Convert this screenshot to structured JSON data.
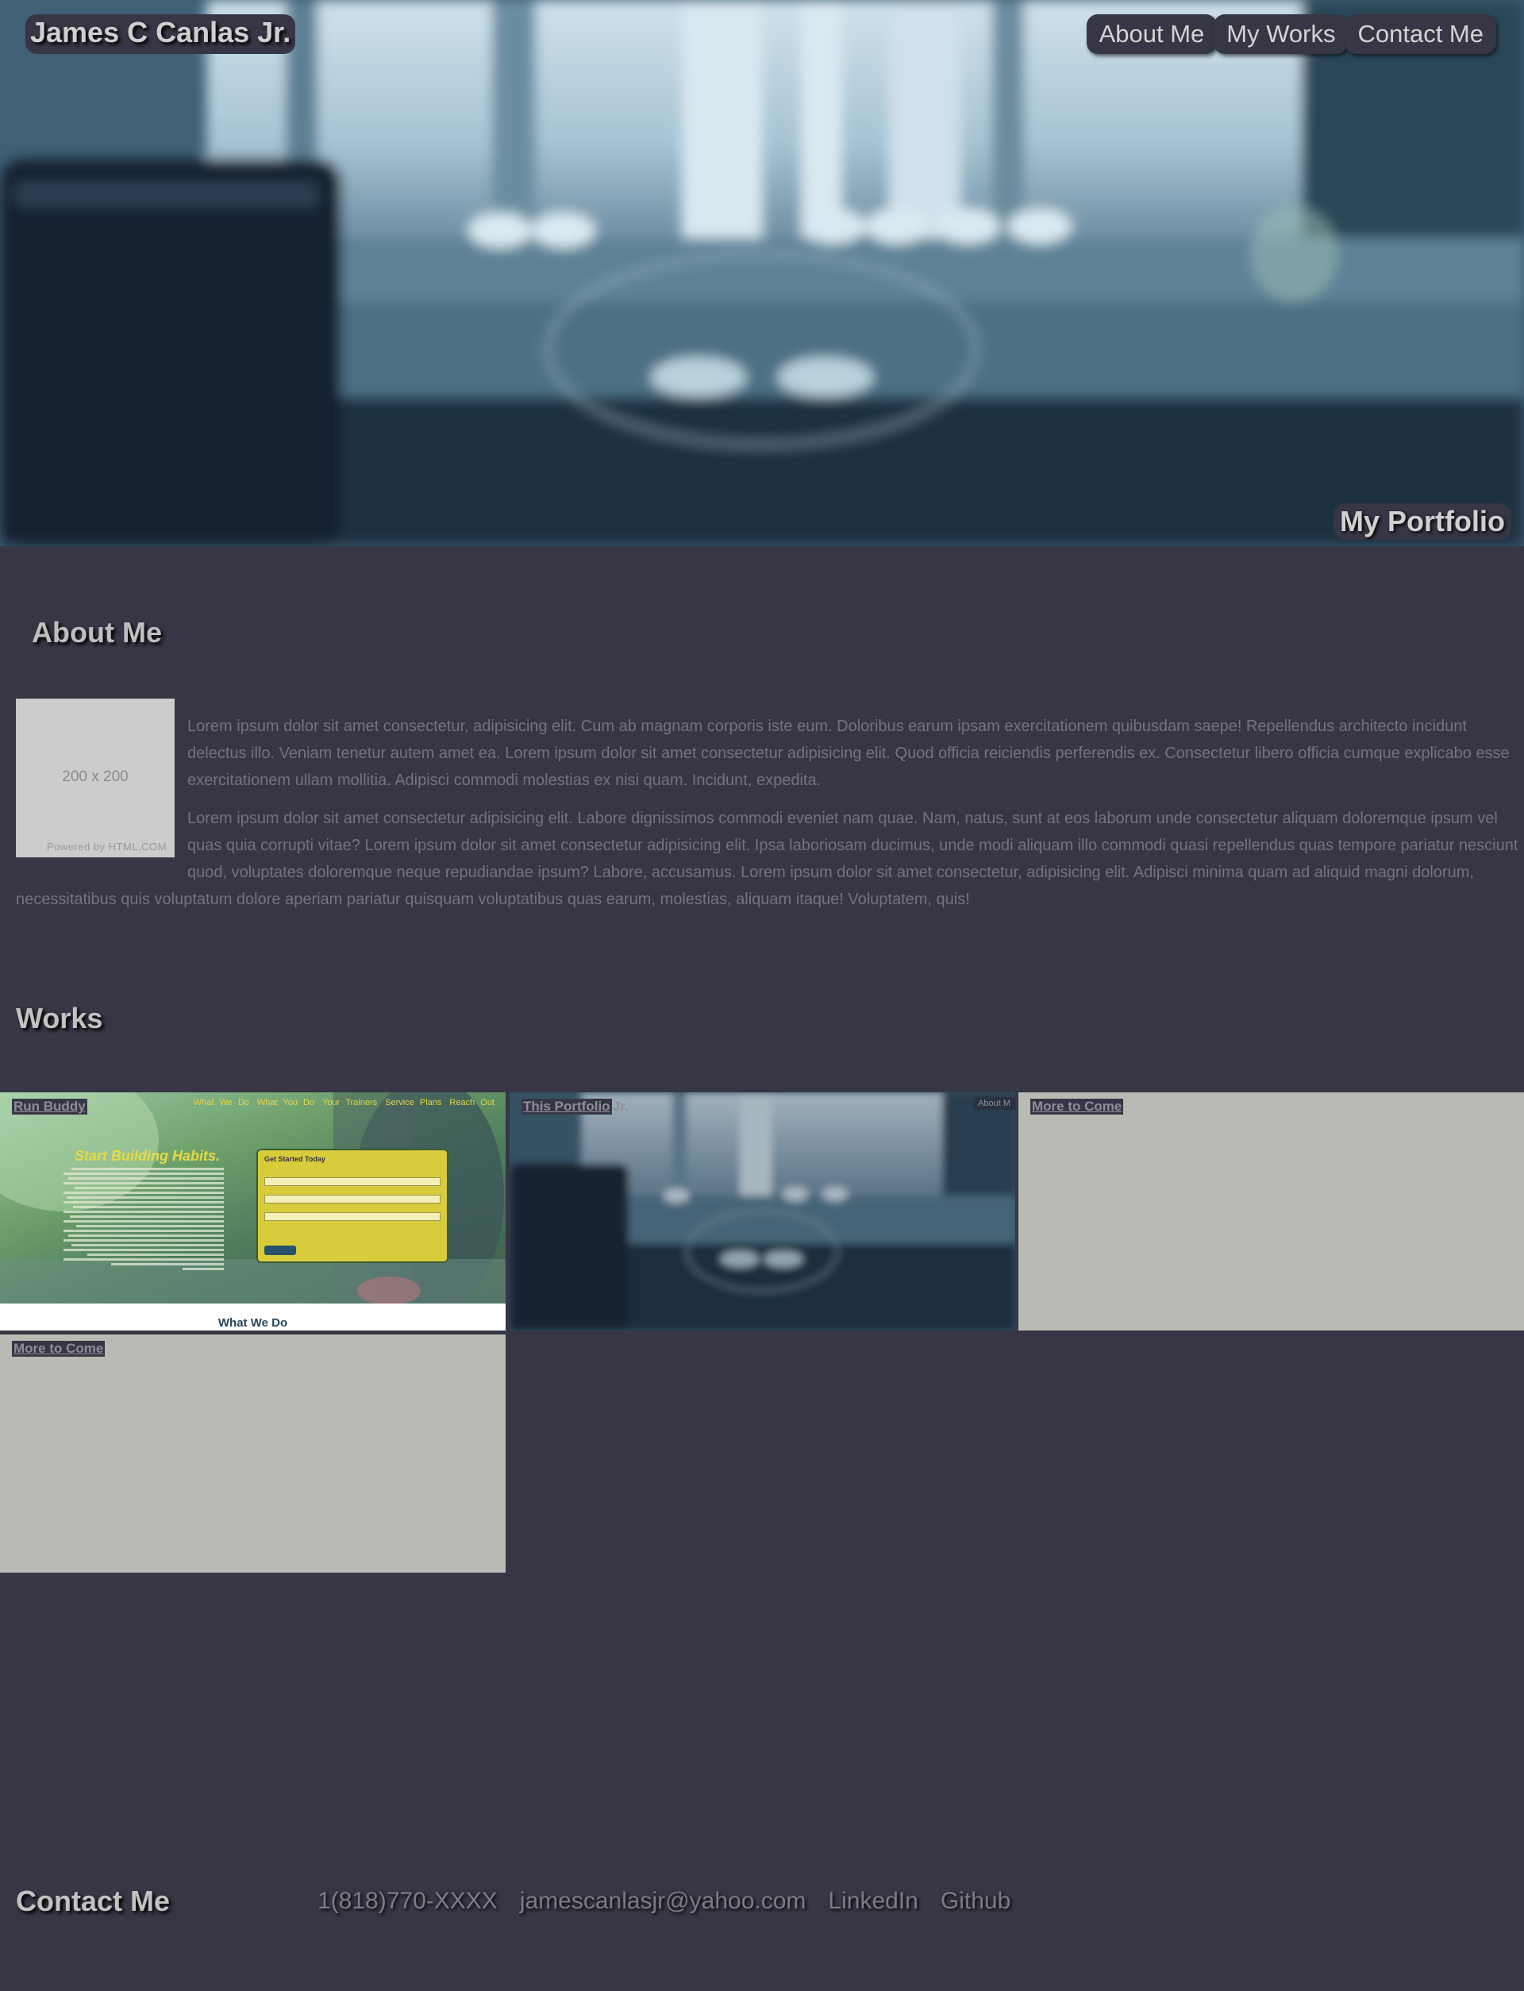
{
  "header": {
    "brand": "James C Canlas Jr.",
    "nav": [
      {
        "label": "About Me"
      },
      {
        "label": "My Works"
      },
      {
        "label": "Contact Me"
      }
    ],
    "hero_title": "My Portfolio"
  },
  "about": {
    "heading": "About Me",
    "image": {
      "size_label": "200 x 200",
      "powered_by": "Powered by HTML.COM"
    },
    "paragraphs": [
      "Lorem ipsum dolor sit amet consectetur, adipisicing elit. Cum ab magnam corporis iste eum. Doloribus earum ipsam exercitationem quibusdam saepe! Repellendus architecto incidunt delectus illo. Veniam tenetur autem amet ea. Lorem ipsum dolor sit amet consectetur adipisicing elit. Quod officia reiciendis perferendis ex. Consectetur libero officia cumque explicabo esse exercitationem ullam mollitia. Adipisci commodi molestias ex nisi quam. Incidunt, expedita.",
      "Lorem ipsum dolor sit amet consectetur adipisicing elit. Labore dignissimos commodi eveniet nam quae. Nam, natus, sunt at eos laborum unde consectetur aliquam doloremque ipsum vel quas quia corrupti vitae? Lorem ipsum dolor sit amet consectetur adipisicing elit. Ipsa laboriosam ducimus, unde modi aliquam illo commodi quasi repellendus quas tempore pariatur nesciunt quod, voluptates doloremque neque repudiandae ipsum? Labore, accusamus. Lorem ipsum dolor sit amet consectetur, adipisicing elit. Adipisci minima quam ad aliquid magni dolorum, necessitatibus quis voluptatum dolore aperiam pariatur quisquam voluptatibus quas earum, molestias, aliquam itaque! Voluptatem, quis!"
    ]
  },
  "works": {
    "heading": "Works",
    "items": [
      {
        "label": "Run Buddy",
        "preview": {
          "nav": [
            "What We Do",
            "What You Do",
            "Your Trainers",
            "Service Plans",
            "Reach Out"
          ],
          "headline": "Start Building Habits.",
          "form_title": "Get Started Today",
          "footer_heading": "What We Do"
        }
      },
      {
        "label": "This Portfolio",
        "preview": {
          "brand_fragment": "Jr.",
          "nav_fragment": "About M"
        }
      },
      {
        "label": "More to Come"
      },
      {
        "label": "More to Come"
      }
    ]
  },
  "contact": {
    "heading": "Contact Me",
    "phone": "1(818)770-XXXX",
    "email": "jamescanlasjr@yahoo.com",
    "linkedin": "LinkedIn",
    "github": "Github"
  },
  "colors": {
    "page_bg": "#373645",
    "placeholder_tile": "#b9bab3"
  }
}
